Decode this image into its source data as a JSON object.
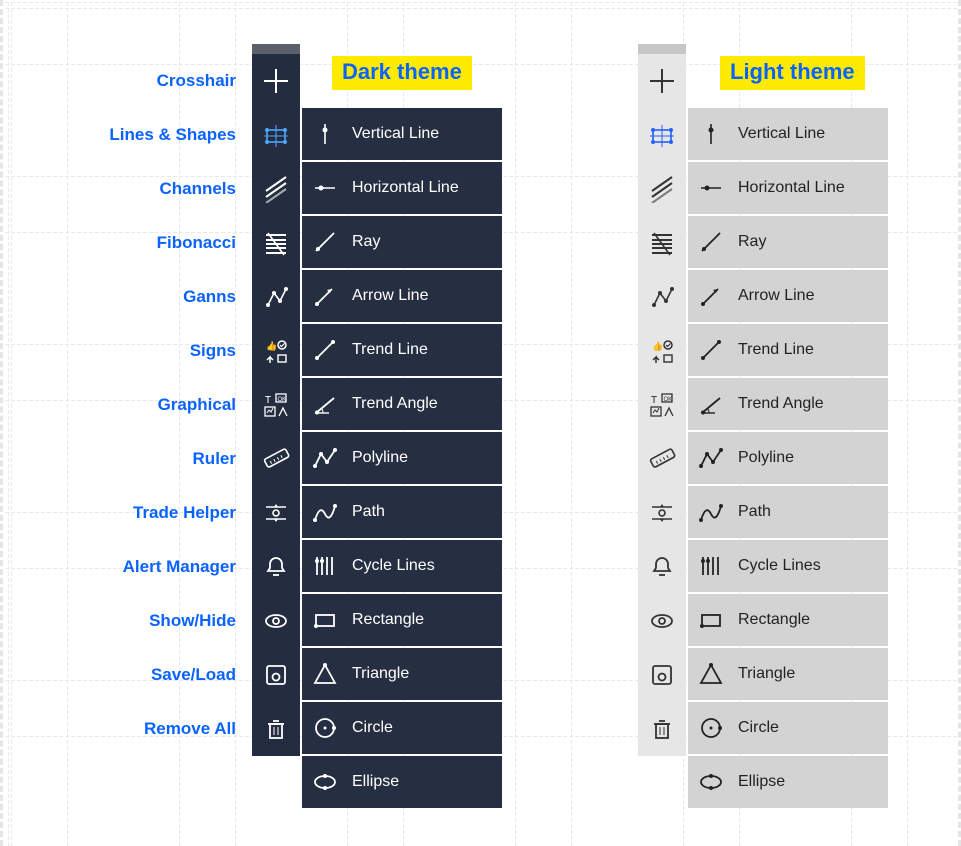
{
  "themes": {
    "dark_title": "Dark theme",
    "light_title": "Light theme"
  },
  "categories": [
    {
      "label": "Crosshair",
      "icon": "crosshair"
    },
    {
      "label": "Lines & Shapes",
      "icon": "lines-shapes",
      "selected": true
    },
    {
      "label": "Channels",
      "icon": "channels"
    },
    {
      "label": "Fibonacci",
      "icon": "fibonacci"
    },
    {
      "label": "Ganns",
      "icon": "ganns"
    },
    {
      "label": "Signs",
      "icon": "signs"
    },
    {
      "label": "Graphical",
      "icon": "graphical"
    },
    {
      "label": "Ruler",
      "icon": "ruler"
    },
    {
      "label": "Trade Helper",
      "icon": "trade-helper"
    },
    {
      "label": "Alert Manager",
      "icon": "alert-manager"
    },
    {
      "label": "Show/Hide",
      "icon": "show-hide"
    },
    {
      "label": "Save/Load",
      "icon": "save-load"
    },
    {
      "label": "Remove All",
      "icon": "remove-all"
    }
  ],
  "flyout_items": [
    {
      "label": "Vertical Line",
      "icon": "vertical-line"
    },
    {
      "label": "Horizontal Line",
      "icon": "horizontal-line"
    },
    {
      "label": "Ray",
      "icon": "ray"
    },
    {
      "label": "Arrow Line",
      "icon": "arrow-line"
    },
    {
      "label": "Trend Line",
      "icon": "trend-line"
    },
    {
      "label": "Trend Angle",
      "icon": "trend-angle"
    },
    {
      "label": "Polyline",
      "icon": "polyline"
    },
    {
      "label": "Path",
      "icon": "path"
    },
    {
      "label": "Cycle Lines",
      "icon": "cycle-lines"
    },
    {
      "label": "Rectangle",
      "icon": "rectangle"
    },
    {
      "label": "Triangle",
      "icon": "triangle"
    },
    {
      "label": "Circle",
      "icon": "circle"
    },
    {
      "label": "Ellipse",
      "icon": "ellipse"
    }
  ]
}
